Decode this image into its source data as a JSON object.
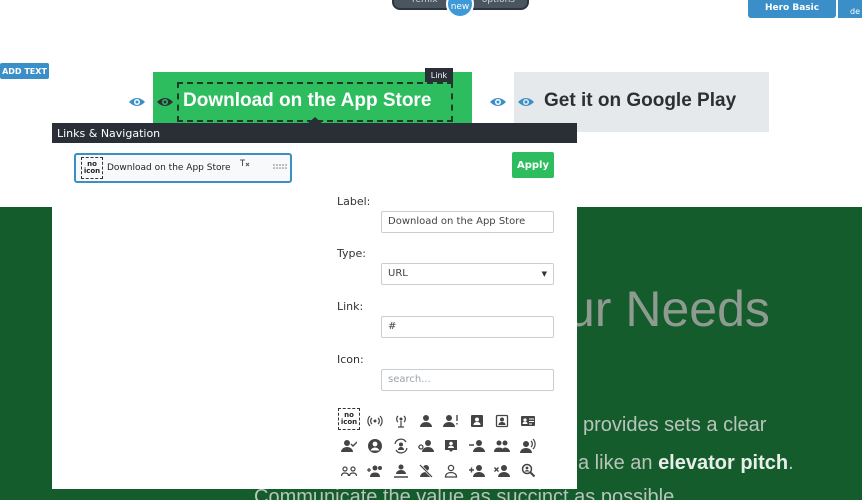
{
  "top_bar": {
    "remix": "remix",
    "new": "new",
    "options": "options"
  },
  "hero": {
    "label": "Hero Basic",
    "extra": "de"
  },
  "add_text": "ADD TEXT",
  "buttons": {
    "app_store": "Download on the App Store",
    "google_play": "Get it on Google Play",
    "link_tag": "Link"
  },
  "panel": {
    "title": "Links & Navigation",
    "item": {
      "no_icon": "no icon",
      "label": "Download on the App Store"
    },
    "apply": "Apply",
    "label_field": {
      "label": "Label:",
      "value": "Download on the App Store"
    },
    "type_field": {
      "label": "Type:",
      "value": "URL"
    },
    "link_field": {
      "label": "Link:",
      "value": "#"
    },
    "icon_field": {
      "label": "Icon:",
      "placeholder": "search..."
    },
    "no_icon": "no icon"
  },
  "background": {
    "heading": "ur Needs",
    "line1": "provides sets a clear",
    "line2_pre": "a like an ",
    "line2_bold": "elevator pitch",
    "line2_post": ".",
    "line3": "Communicate the value as succinct as possible."
  },
  "icons": [
    "broadcast-icon",
    "podcast-icon",
    "person-icon",
    "person-alert-icon",
    "contact-card-icon",
    "contact-frame-icon",
    "id-card-icon",
    "person-check-icon",
    "account-circle-icon",
    "person-refresh-icon",
    "person-key-icon",
    "person-box-icon",
    "person-remove-icon",
    "people-icon",
    "person-speaking-icon",
    "group-icon",
    "group-add-icon",
    "person-pin-icon",
    "person-off-icon",
    "person-outline-icon",
    "person-add-icon",
    "person-cancel-icon",
    "person-search-icon"
  ],
  "colors": {
    "accent_blue": "#3b8fc8",
    "green": "#2dbd5e",
    "dark": "#2a2f37",
    "page_green": "#145c2c"
  }
}
